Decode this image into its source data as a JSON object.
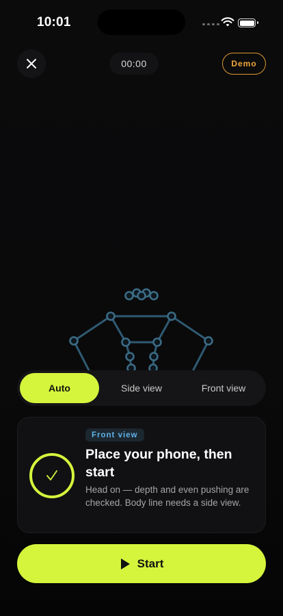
{
  "status_bar": {
    "time": "10:01"
  },
  "header": {
    "timer": "00:00",
    "demo_label": "Demo"
  },
  "view_mode": {
    "options": [
      {
        "label": "Auto",
        "selected": true
      },
      {
        "label": "Side view",
        "selected": false
      },
      {
        "label": "Front view",
        "selected": false
      }
    ]
  },
  "card": {
    "badge": "Front view",
    "title": "Place your phone, then start",
    "description": "Head on — depth and even pushing are checked. Body line needs a side view."
  },
  "start_button": {
    "label": "Start"
  },
  "colors": {
    "accent": "#d4f53c",
    "demo": "#f2a93b",
    "badge_text": "#5fb3e8",
    "skeleton": "#2f5a72",
    "background": "#0b0b0c"
  },
  "icons": [
    "close-icon",
    "play-icon",
    "check-icon",
    "wifi-icon",
    "battery-icon",
    "signal-icon"
  ]
}
